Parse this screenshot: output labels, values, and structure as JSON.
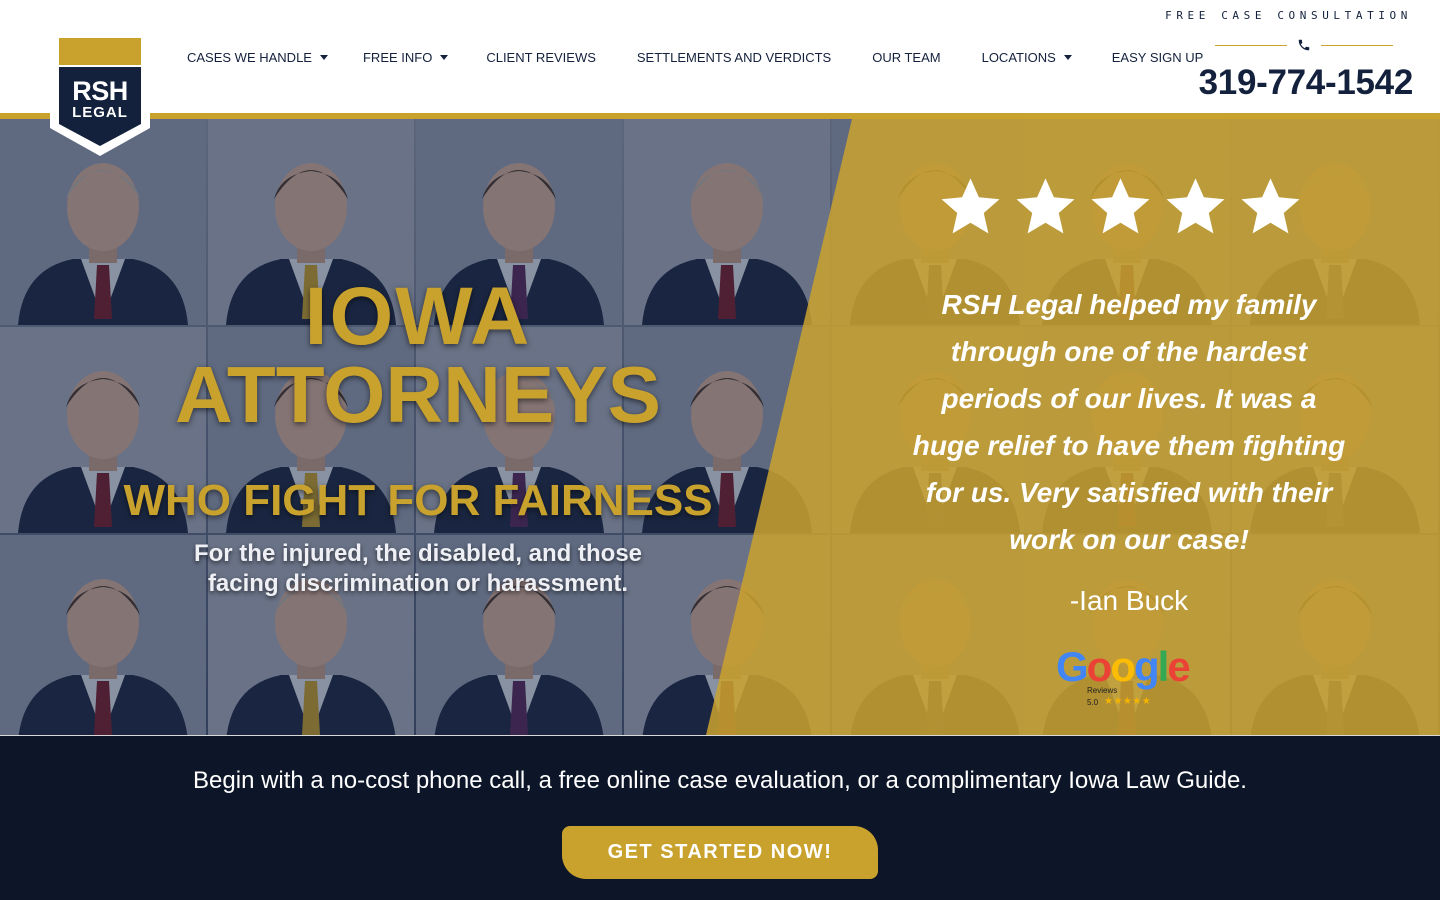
{
  "brand": {
    "logo_line1": "RSH",
    "logo_line2": "LEGAL"
  },
  "nav": {
    "items": [
      {
        "label": "CASES WE HANDLE",
        "dropdown": true
      },
      {
        "label": "FREE INFO",
        "dropdown": true
      },
      {
        "label": "CLIENT REVIEWS",
        "dropdown": false
      },
      {
        "label": "SETTLEMENTS AND VERDICTS",
        "dropdown": false
      },
      {
        "label": "OUR TEAM",
        "dropdown": false
      },
      {
        "label": "LOCATIONS",
        "dropdown": true
      },
      {
        "label": "EASY SIGN UP",
        "dropdown": false
      }
    ]
  },
  "contact": {
    "consultation_label": "FREE CASE CONSULTATION",
    "phone_icon": "phone-icon",
    "phone": "319-774-1542"
  },
  "hero": {
    "headline_1": "IOWA",
    "headline_2": "ATTORNEYS",
    "headline_3": "WHO FIGHT FOR FAIRNESS",
    "subline_1": "For the injured, the disabled, and those",
    "subline_2": "facing discrimination or harassment."
  },
  "testimonial": {
    "star_count": 5,
    "star_icon": "star-icon",
    "lines": [
      "RSH Legal helped my family",
      "through one of the hardest",
      "periods of our lives. It was a",
      "huge relief to have them fighting",
      "for us. Very satisfied with their",
      "work on our case!"
    ],
    "author": "-Ian Buck",
    "badge": {
      "word": "Google",
      "sub": "Reviews",
      "rating": "5.0",
      "stars": "★★★★★"
    }
  },
  "cta": {
    "text": "Begin with a no-cost phone call, a free online case evaluation, or a complimentary Iowa Law Guide.",
    "button_label": "GET STARTED NOW!"
  },
  "colors": {
    "gold": "#c9a22e",
    "navy": "#14213d",
    "dark_navy": "#0d1528",
    "white": "#ffffff"
  }
}
